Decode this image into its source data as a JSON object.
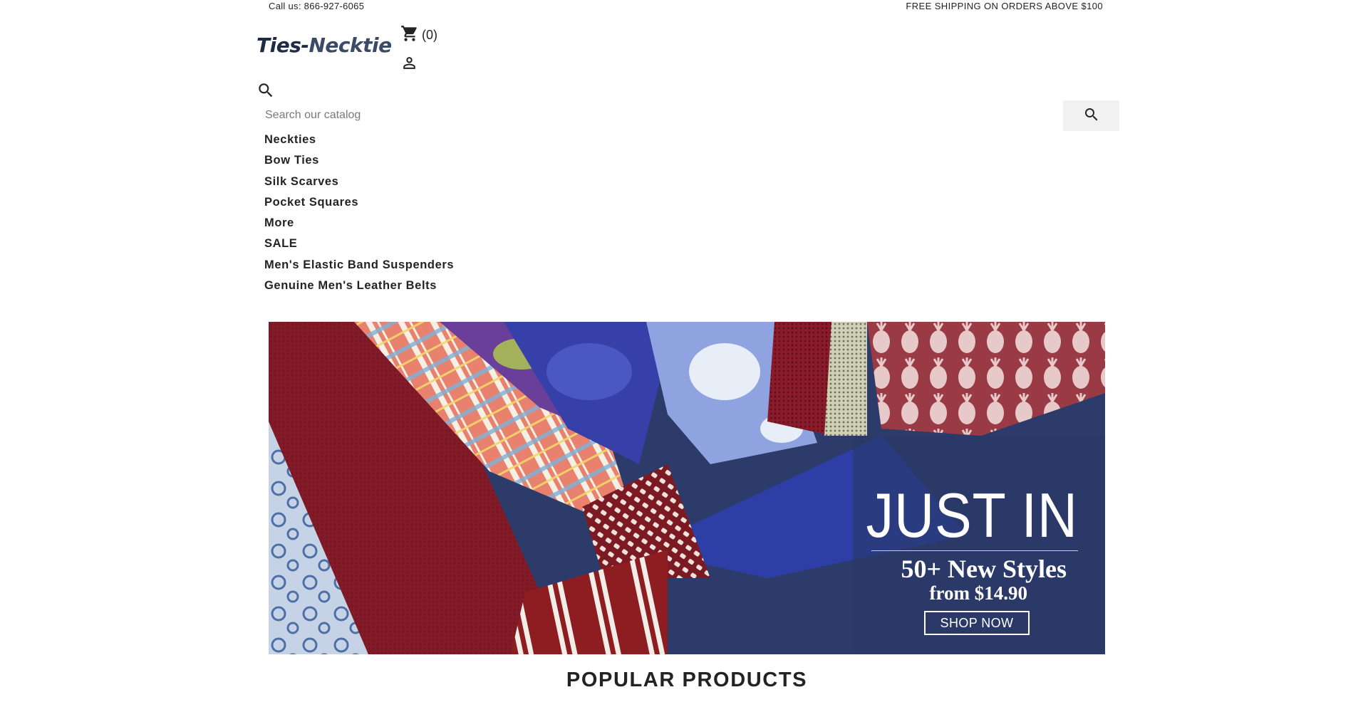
{
  "topbar": {
    "phone_text": "Call us: 866-927-6065",
    "shipping_text": "FREE SHIPPING ON ORDERS ABOVE $100"
  },
  "header": {
    "logo_part1": "Ties-",
    "logo_part2": "Necktie",
    "cart_count": "(0)",
    "cart_icon": "shopping-cart-icon",
    "user_icon": "user-icon"
  },
  "search": {
    "placeholder": "Search our catalog",
    "icon": "search-icon"
  },
  "menu": {
    "items": [
      "Neckties",
      "Bow Ties",
      "Silk Scarves",
      "Pocket Squares",
      "More",
      "SALE",
      "Men's Elastic Band Suspenders",
      "Genuine Men's Leather Belts"
    ]
  },
  "banner": {
    "title": "JUST IN",
    "line1": "50+ New Styles",
    "line2": "from $14.90",
    "cta": "SHOP NOW"
  },
  "sections": {
    "popular_title": "POPULAR PRODUCTS"
  },
  "colors": {
    "text": "#232323",
    "logo": "#1d2b45",
    "search_button_bg": "#f1f1f1",
    "banner_bg": "#2c3a66"
  }
}
